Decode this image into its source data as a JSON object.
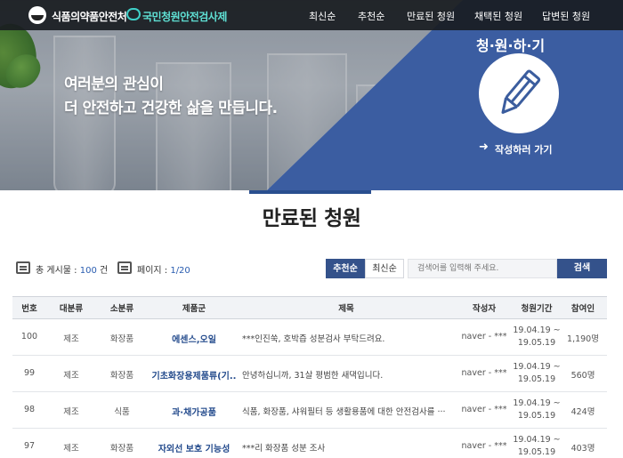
{
  "header": {
    "brand": "식품의약품안전처",
    "sub_brand": "국민청원안전검사제",
    "nav": [
      "최신순",
      "추천순",
      "만료된 청원",
      "채택된 청원",
      "답변된 청원"
    ]
  },
  "hero": {
    "line1": "여러분의 관심이",
    "line2": "더 안전하고 건강한 삶을 만듭니다.",
    "petition_title": "청·원·하·기",
    "write_link": "작성하러 가기"
  },
  "page": {
    "title": "만료된 청원"
  },
  "info": {
    "total_label": "총 게시물 : ",
    "total_count": "100",
    "total_unit": " 건",
    "page_label": "페이지 : ",
    "page_value": "1/20"
  },
  "sort": {
    "recommend": "추천순",
    "latest": "최신순"
  },
  "search": {
    "placeholder": "검색어를 입력해 주세요.",
    "button": "검색"
  },
  "table": {
    "headers": [
      "번호",
      "대분류",
      "소분류",
      "제품군",
      "제목",
      "작성자",
      "청원기간",
      "참여인"
    ],
    "rows": [
      {
        "no": "100",
        "cat": "제조",
        "sub": "화장품",
        "group": "에센스,오일",
        "subject": "***인진쑥, 호박즙 성분검사 부탁드려요.",
        "author": "naver - ***",
        "p1": "19.04.19 ~",
        "p2": "19.05.19",
        "count": "1,190명"
      },
      {
        "no": "99",
        "cat": "제조",
        "sub": "화장품",
        "group": "기초화장용제품류(기..",
        "subject": "안녕하십니까, 31살 평범한 새댁입니다.",
        "author": "naver - ***",
        "p1": "19.04.19 ~",
        "p2": "19.05.19",
        "count": "560명"
      },
      {
        "no": "98",
        "cat": "제조",
        "sub": "식품",
        "group": "과·채가공품",
        "subject": "식품, 화장품, 샤워필터 등 생활용품에 대한 안전검사를 ···",
        "author": "naver - ***",
        "p1": "19.04.19 ~",
        "p2": "19.05.19",
        "count": "424명"
      },
      {
        "no": "97",
        "cat": "제조",
        "sub": "화장품",
        "group": "자외선 보호 기능성",
        "subject": "***리 화장품 성분 조사",
        "author": "naver - ***",
        "p1": "19.04.19 ~",
        "p2": "19.05.19",
        "count": "403명"
      }
    ]
  },
  "icons": [
    "gov-logo-icon",
    "chat-bubble-icon",
    "pencil-icon",
    "arrow-right-icon",
    "board-icon",
    "page-icon"
  ],
  "colors": {
    "accent": "#34528b",
    "hero_blue": "#3b5da1",
    "group_text": "#234a8c"
  }
}
